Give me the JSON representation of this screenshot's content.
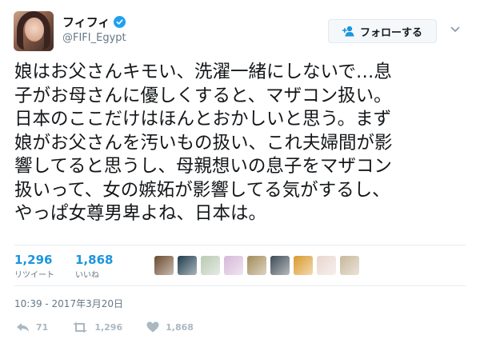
{
  "user": {
    "display_name": "フィフィ",
    "handle": "@FIFI_Egypt"
  },
  "follow_button": {
    "label": "フォローする"
  },
  "tweet": {
    "lines": [
      "娘はお父さんキモい、洗濯一緒にしないで…息",
      "子がお母さんに優しくすると、マザコン扱い。",
      "日本のここだけはほんとおかしいと思う。まず",
      "娘がお父さんを汚いもの扱い、これ夫婦間が影",
      "響してると思うし、母親想いの息子をマザコン",
      "扱いって、女の嫉妬が影響してる気がするし、",
      "やっぱ女尊男卑よね、日本は。"
    ]
  },
  "stats": {
    "retweets": {
      "value": "1,296",
      "label": "リツイート"
    },
    "likes": {
      "value": "1,868",
      "label": "いいね"
    }
  },
  "timestamp": "10:39 - 2017年3月20日",
  "actions": {
    "reply_count": "71",
    "retweet_count": "1,296",
    "like_count": "1,868"
  },
  "liker_avatars": [
    {
      "icon": "liker-avatar",
      "color": "#6b4a2e"
    },
    {
      "icon": "liker-avatar",
      "color": "#1f3b4d"
    },
    {
      "icon": "liker-avatar",
      "color": "#b9c9b3"
    },
    {
      "icon": "liker-avatar",
      "color": "#d6b8d8"
    },
    {
      "icon": "liker-avatar",
      "color": "#a28b5a"
    },
    {
      "icon": "liker-avatar",
      "color": "#3d4a55"
    },
    {
      "icon": "liker-avatar",
      "color": "#d99a2b"
    },
    {
      "icon": "liker-avatar",
      "color": "#e8d6cf"
    },
    {
      "icon": "liker-avatar",
      "color": "#c7b79a"
    }
  ],
  "colors": {
    "accent": "#1b95e0",
    "verified": "#1da1f2",
    "muted": "#657786",
    "action_gray": "#aab8c2"
  }
}
